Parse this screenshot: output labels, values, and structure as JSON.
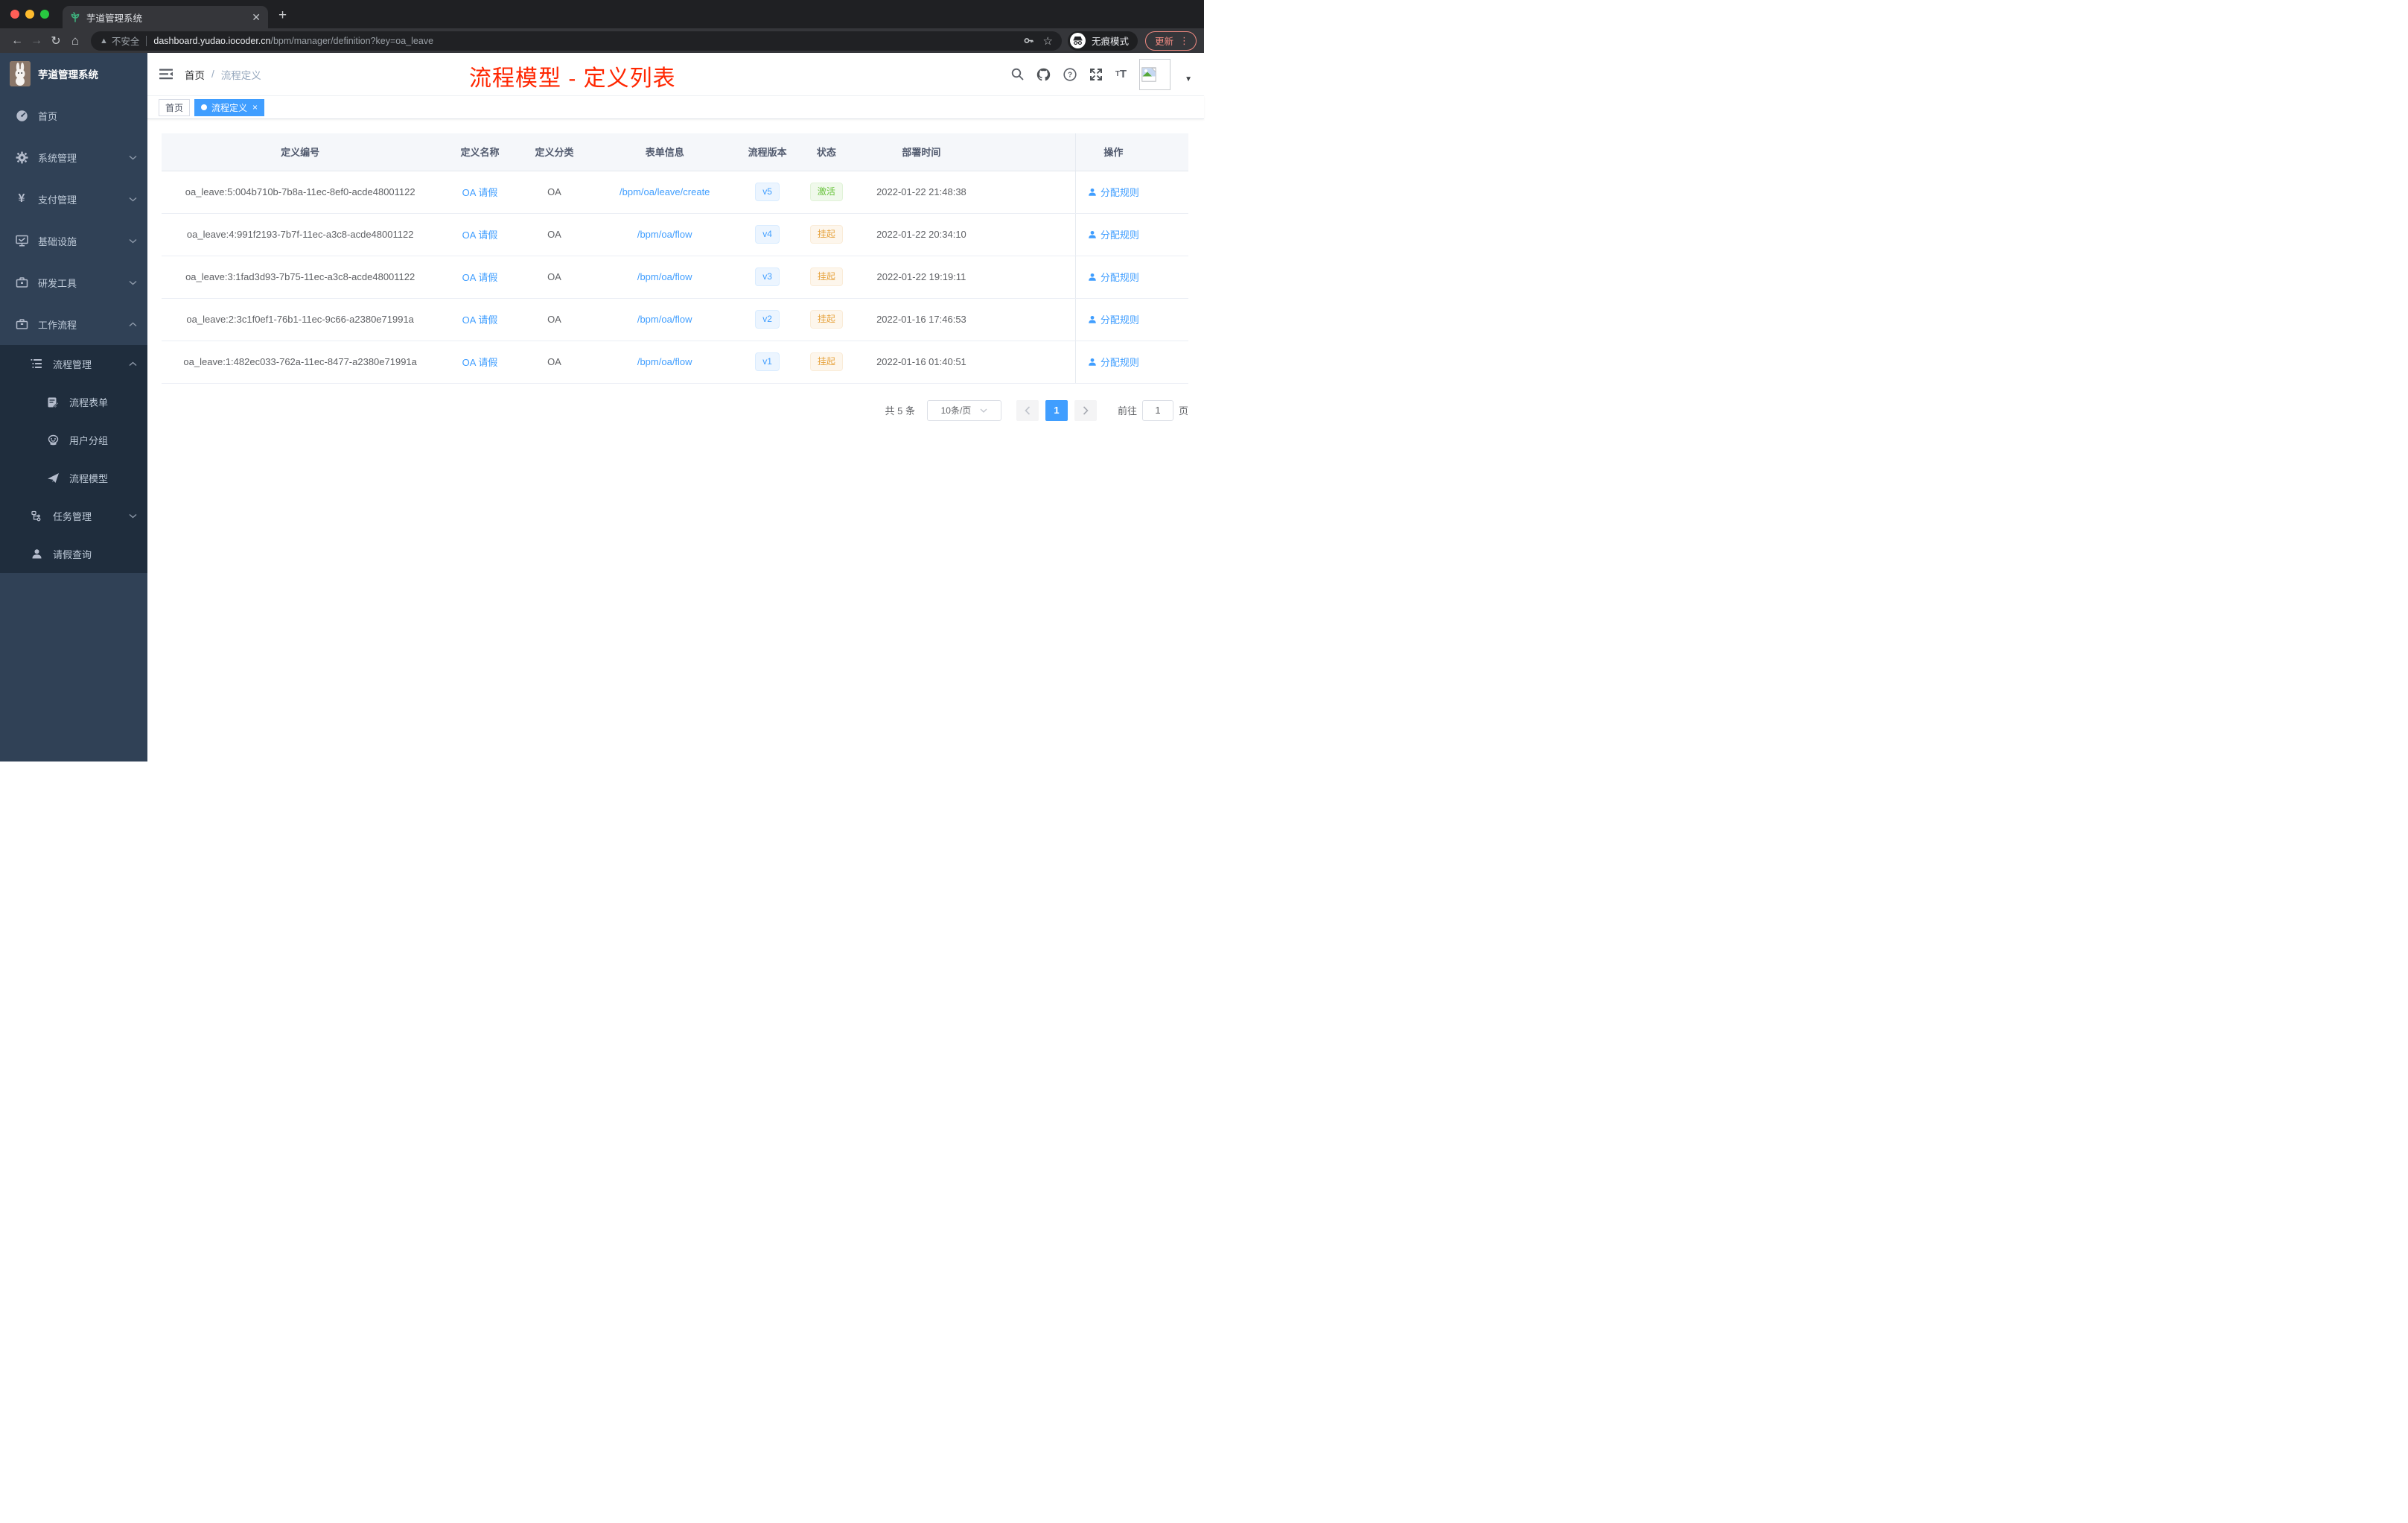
{
  "browser": {
    "tab_title": "芋道管理系统",
    "security_label": "不安全",
    "url_host": "dashboard.yudao.iocoder.cn",
    "url_path": "/bpm/manager/definition?key=oa_leave",
    "incognito_label": "无痕模式",
    "update_label": "更新",
    "icons": [
      "back-icon",
      "forward-icon",
      "reload-icon",
      "home-icon",
      "warning-icon",
      "key-icon",
      "star-icon",
      "incognito-icon",
      "menu-dots-icon"
    ]
  },
  "sidebar": {
    "logo_title": "芋道管理系统",
    "items": [
      {
        "label": "首页",
        "icon": "dashboard-icon",
        "level": 1
      },
      {
        "label": "系统管理",
        "icon": "gear-icon",
        "level": 1,
        "chevron": "down"
      },
      {
        "label": "支付管理",
        "icon": "yen-icon",
        "level": 1,
        "chevron": "down"
      },
      {
        "label": "基础设施",
        "icon": "monitor-icon",
        "level": 1,
        "chevron": "down"
      },
      {
        "label": "研发工具",
        "icon": "toolbox-icon",
        "level": 1,
        "chevron": "down"
      },
      {
        "label": "工作流程",
        "icon": "briefcase-icon",
        "level": 1,
        "chevron": "up"
      },
      {
        "label": "流程管理",
        "icon": "list-tree-icon",
        "level": 2,
        "chevron": "up"
      },
      {
        "label": "流程表单",
        "icon": "form-icon",
        "level": 3
      },
      {
        "label": "用户分组",
        "icon": "robot-icon",
        "level": 3
      },
      {
        "label": "流程模型",
        "icon": "send-icon",
        "level": 3
      },
      {
        "label": "任务管理",
        "icon": "flow-tree-icon",
        "level": 2,
        "chevron": "down"
      },
      {
        "label": "请假查询",
        "icon": "user-icon",
        "level": 2
      }
    ]
  },
  "header": {
    "breadcrumb_home": "首页",
    "breadcrumb_separator": "/",
    "breadcrumb_current": "流程定义",
    "annotation": "流程模型 - 定义列表",
    "annotation_color": "#ff2600",
    "icons": [
      "hamburger-icon",
      "search-icon",
      "github-icon",
      "help-icon",
      "fullscreen-icon",
      "font-size-icon",
      "avatar-image",
      "caret-down-icon"
    ]
  },
  "tags": {
    "home": "首页",
    "active_label": "流程定义",
    "active_close": "×"
  },
  "table": {
    "columns": [
      "定义编号",
      "定义名称",
      "定义分类",
      "表单信息",
      "流程版本",
      "状态",
      "部署时间",
      "操作"
    ],
    "rows": [
      {
        "id": "oa_leave:5:004b710b-7b8a-11ec-8ef0-acde48001122",
        "name": "OA 请假",
        "category": "OA",
        "form": "/bpm/oa/leave/create",
        "version": "v5",
        "status": "激活",
        "status_type": "success",
        "deploy_time": "2022-01-22 21:48:38",
        "action": "分配规则"
      },
      {
        "id": "oa_leave:4:991f2193-7b7f-11ec-a3c8-acde48001122",
        "name": "OA 请假",
        "category": "OA",
        "form": "/bpm/oa/flow",
        "version": "v4",
        "status": "挂起",
        "status_type": "warning",
        "deploy_time": "2022-01-22 20:34:10",
        "action": "分配规则"
      },
      {
        "id": "oa_leave:3:1fad3d93-7b75-11ec-a3c8-acde48001122",
        "name": "OA 请假",
        "category": "OA",
        "form": "/bpm/oa/flow",
        "version": "v3",
        "status": "挂起",
        "status_type": "warning",
        "deploy_time": "2022-01-22 19:19:11",
        "action": "分配规则"
      },
      {
        "id": "oa_leave:2:3c1f0ef1-76b1-11ec-9c66-a2380e71991a",
        "name": "OA 请假",
        "category": "OA",
        "form": "/bpm/oa/flow",
        "version": "v2",
        "status": "挂起",
        "status_type": "warning",
        "deploy_time": "2022-01-16 17:46:53",
        "action": "分配规则"
      },
      {
        "id": "oa_leave:1:482ec033-762a-11ec-8477-a2380e71991a",
        "name": "OA 请假",
        "category": "OA",
        "form": "/bpm/oa/flow",
        "version": "v1",
        "status": "挂起",
        "status_type": "warning",
        "deploy_time": "2022-01-16 01:40:51",
        "action": "分配规则"
      }
    ]
  },
  "pagination": {
    "total": "共 5 条",
    "page_size": "10条/页",
    "current_page": "1",
    "goto_label": "前往",
    "goto_value": "1",
    "page_unit": "页"
  },
  "colors": {
    "accent_blue": "#409eff",
    "annotation_red": "#ff2600",
    "status_active_green": "#67c23a",
    "status_suspend_yellow": "#e6a23c",
    "sidebar_bg": "#304156",
    "submenu_bg": "#1f2d3d"
  }
}
